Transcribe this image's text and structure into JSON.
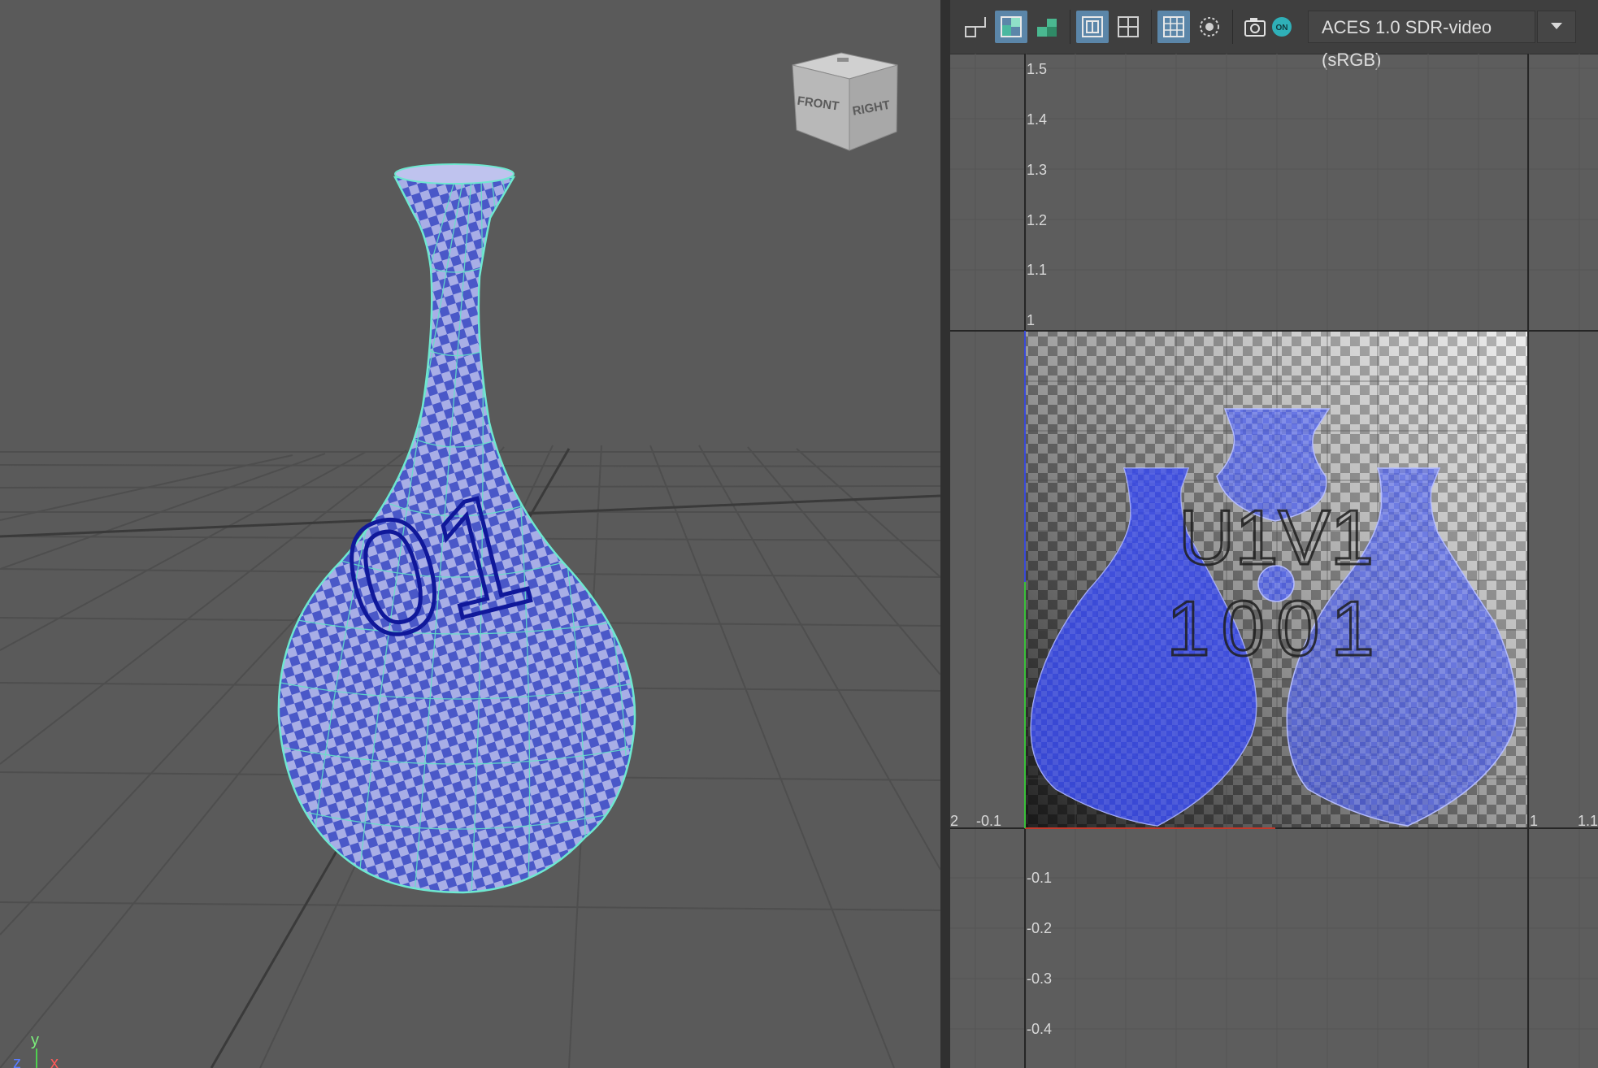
{
  "viewport": {
    "view_cube": {
      "front_label": "FRONT",
      "right_label": "RIGHT"
    },
    "axis_indicator": {
      "y_label": "y",
      "z_label": "z",
      "x_label": "x"
    },
    "object_text": "01"
  },
  "uv_editor": {
    "toolbar": {
      "buttons": [
        {
          "name": "uv-shell-border-icon",
          "active": false
        },
        {
          "name": "uv-distortion-icon",
          "active": true
        },
        {
          "name": "uv-checker-shade-icon",
          "active": false
        },
        {
          "name": "uv-tile-grid-icon",
          "active": true
        },
        {
          "name": "uv-pixel-snap-icon",
          "active": false
        },
        {
          "name": "uv-grid-icon",
          "active": true
        },
        {
          "name": "uv-image-dim-icon",
          "active": false
        },
        {
          "name": "snapshot-camera-icon",
          "active": false
        },
        {
          "name": "color-management-on-icon",
          "active": false
        }
      ],
      "color_management_badge": "ON",
      "color_space": "ACES 1.0 SDR-video (sRGB)"
    },
    "v_ticks": [
      "1.5",
      "1.4",
      "1.3",
      "1.2",
      "1.1",
      "1",
      "-0.1",
      "-0.2",
      "-0.3",
      "-0.4"
    ],
    "u_ticks": [
      "2",
      "-0.1",
      "1",
      "1.1"
    ],
    "tile_label_top": "U1V1",
    "tile_label_bottom": "1001"
  }
}
